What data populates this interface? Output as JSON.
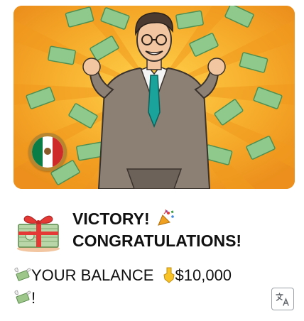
{
  "post": {
    "headline_line1": "VICTORY!",
    "headline_line2": "CONGRATULATIONS!",
    "balance_text": "YOUR BALANCE",
    "balance_amount": "$10,000",
    "balance_suffix": "!"
  },
  "icons": {
    "hero": "man-with-money-rain-illustration",
    "flag": "mexico-flag-icon",
    "gift": "money-gift-icon",
    "party": "party-popper-icon",
    "money": "money-with-wings-icon",
    "hand": "backhand-index-pointing-down-icon",
    "translate": "translate-icon"
  },
  "colors": {
    "hero_background": "#f3a42a",
    "flag_green": "#0a7c45",
    "flag_red": "#cf2a2a",
    "badge_ring": "#b8862f"
  }
}
